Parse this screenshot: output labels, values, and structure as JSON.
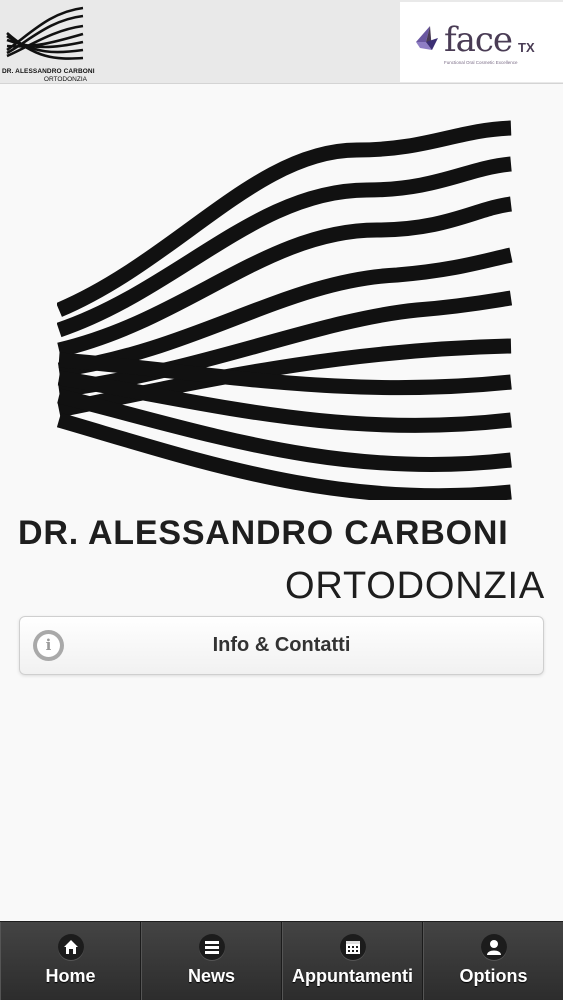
{
  "header": {
    "logo_name": "DR. ALESSANDRO CARBONI",
    "logo_subtitle": "ORTODONZIA",
    "sponsor": {
      "name": "face",
      "suffix": "TX",
      "tagline": "Functional Oral Cosmetic Excellence"
    }
  },
  "main": {
    "name": "DR. ALESSANDRO CARBONI",
    "subtitle": "ORTODONZIA",
    "info_button_label": "Info & Contatti"
  },
  "nav": {
    "items": [
      {
        "label": "Home",
        "icon": "home-icon"
      },
      {
        "label": "News",
        "icon": "bars-icon"
      },
      {
        "label": "Appuntamenti",
        "icon": "calendar-icon"
      },
      {
        "label": "Options",
        "icon": "user-icon"
      }
    ]
  },
  "colors": {
    "background": "#f9f9f9",
    "header_bg": "#e9e9e9",
    "nav_bg": "#2f2f2f",
    "brand_text": "#1e1e1e",
    "sponsor_purple": "#4a3c55"
  }
}
